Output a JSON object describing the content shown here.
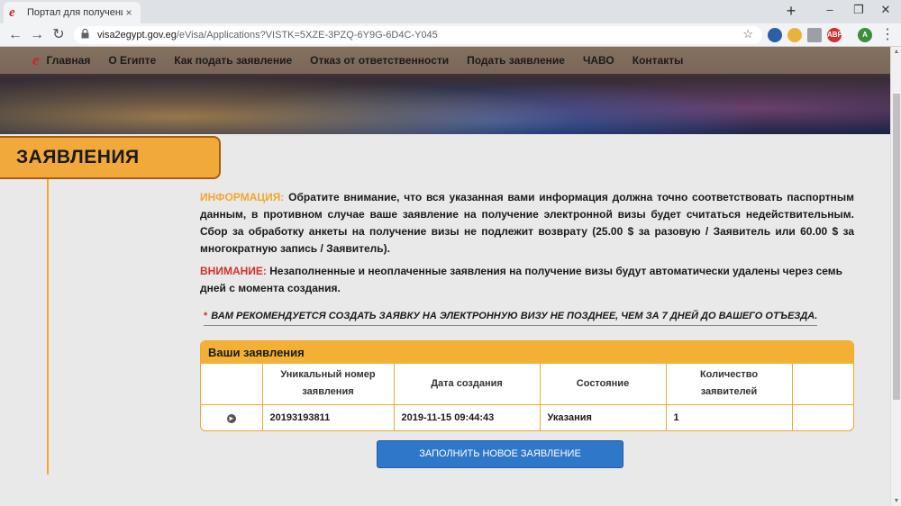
{
  "browser": {
    "tab_title": "Портал для получения",
    "tab_close": "×",
    "new_tab": "+",
    "url_host": "visa2egypt.gov.eg",
    "url_path": "/eVisa/Applications?VISTK=5XZE-3PZQ-6Y9G-6D4C-Y045",
    "ext_abp": "ABP",
    "profile": "A"
  },
  "nav": {
    "logo": "e",
    "items": [
      "Главная",
      "О Египте",
      "Как подать заявление",
      "Отказ от ответственности",
      "Подать заявление",
      "ЧАВО",
      "Контакты"
    ]
  },
  "section": {
    "title": "ЗАЯВЛЕНИЯ"
  },
  "info": {
    "label": "ИНФОРМАЦИЯ:",
    "text": "Обратите внимание, что вся указанная вами информация должна точно соответствовать паспортным данным, в противном случае ваше заявление на получение электронной визы будет считаться недействительным. Сбор за обработку анкеты на получение визы не подлежит возврату (25.00 $ за разовую / Заявитель или 60.00 $ за многократную запись / Заявитель)."
  },
  "warning": {
    "label": "ВНИМАНИЕ:",
    "text": "Незаполненные и неоплаченные заявления на получение визы будут автоматически удалены через семь дней с момента создания."
  },
  "recommend": {
    "asterisk": "*",
    "text": "ВАМ РЕКОМЕНДУЕТСЯ СОЗДАТЬ ЗАЯВКУ НА ЭЛЕКТРОННУЮ ВИЗУ НЕ ПОЗДНЕЕ, ЧЕМ ЗА 7 ДНЕЙ ДО ВАШЕГО ОТЪЕЗДА."
  },
  "applications": {
    "title": "Ваши заявления",
    "headers": [
      "",
      "Уникальный номер заявления",
      "Дата создания",
      "Состояние",
      "Количество заявителей",
      ""
    ],
    "rows": [
      {
        "id": "20193193811",
        "date": "2019-11-15 09:44:43",
        "status": "Указания",
        "count": "1"
      }
    ]
  },
  "new_application_button": "ЗАПОЛНИТЬ НОВОЕ ЗАЯВЛЕНИЕ",
  "colors": {
    "accent": "#f2a93b",
    "info_label": "#f0a830",
    "warn_label": "#d32f2f",
    "button": "#2f77c9"
  }
}
